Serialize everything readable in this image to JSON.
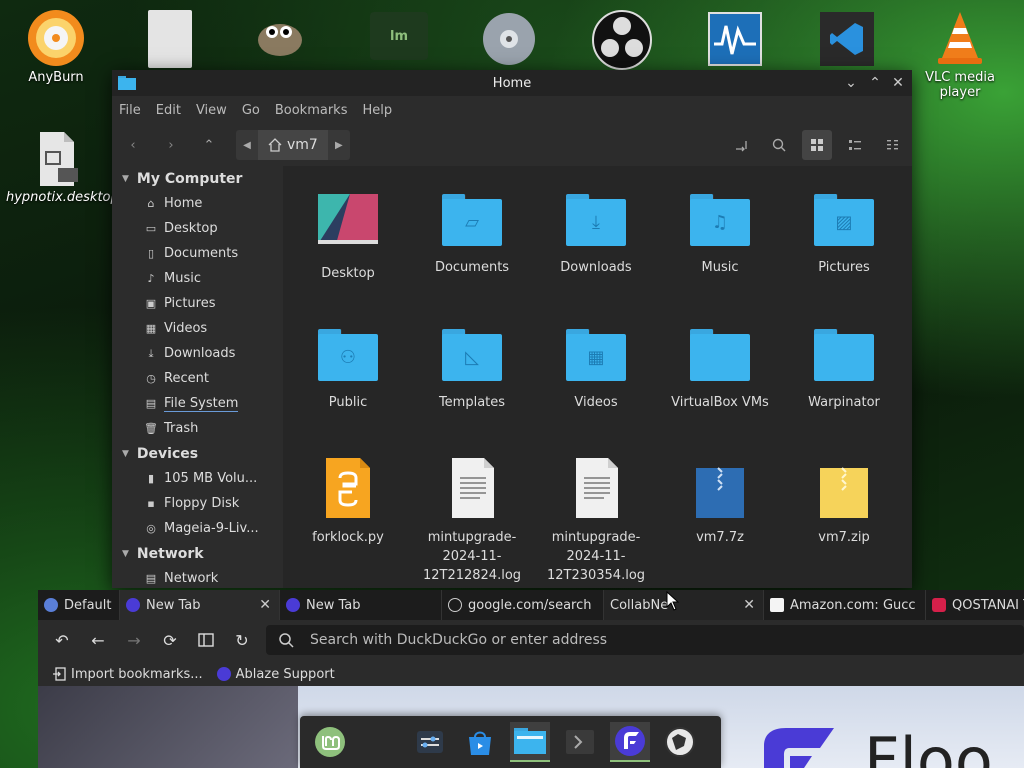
{
  "desktop": {
    "icons": [
      {
        "label": "AnyBurn"
      },
      {
        "label": "hypnotix.desktop"
      },
      {
        "label": "VLC media player"
      }
    ]
  },
  "file_manager": {
    "title": "Home",
    "menu": [
      "File",
      "Edit",
      "View",
      "Go",
      "Bookmarks",
      "Help"
    ],
    "path": "vm7",
    "sidebar": {
      "sections": [
        {
          "title": "My Computer",
          "items": [
            "Home",
            "Desktop",
            "Documents",
            "Music",
            "Pictures",
            "Videos",
            "Downloads",
            "Recent",
            "File System",
            "Trash"
          ]
        },
        {
          "title": "Devices",
          "items": [
            "105 MB Volu...",
            "Floppy Disk",
            "Mageia-9-Liv..."
          ]
        },
        {
          "title": "Network",
          "items": [
            "Network"
          ]
        }
      ]
    },
    "files": [
      {
        "name": "Desktop",
        "kind": "desktop"
      },
      {
        "name": "Documents",
        "kind": "folder",
        "glyph": "document-icon"
      },
      {
        "name": "Downloads",
        "kind": "folder",
        "glyph": "download-icon"
      },
      {
        "name": "Music",
        "kind": "folder",
        "glyph": "music-icon"
      },
      {
        "name": "Pictures",
        "kind": "folder",
        "glyph": "picture-icon"
      },
      {
        "name": "Public",
        "kind": "folder",
        "glyph": "people-icon"
      },
      {
        "name": "Templates",
        "kind": "folder",
        "glyph": "ruler-icon"
      },
      {
        "name": "Videos",
        "kind": "folder",
        "glyph": "film-icon"
      },
      {
        "name": "VirtualBox VMs",
        "kind": "folder",
        "glyph": ""
      },
      {
        "name": "Warpinator",
        "kind": "folder",
        "glyph": ""
      },
      {
        "name": "forklock.py",
        "kind": "python"
      },
      {
        "name": "mintupgrade-2024-11-12T212824.log",
        "line1": "mintupgrade-",
        "line2": "2024-11-",
        "line3": "12T212824.log",
        "kind": "text"
      },
      {
        "name": "mintupgrade-2024-11-12T230354.log",
        "line1": "mintupgrade-",
        "line2": "2024-11-",
        "line3": "12T230354.log",
        "kind": "text"
      },
      {
        "name": "vm7.7z",
        "kind": "archive-blue"
      },
      {
        "name": "vm7.zip",
        "kind": "archive-yellow"
      }
    ]
  },
  "browser": {
    "tabs": [
      {
        "label": "Default",
        "active": false
      },
      {
        "label": "New Tab",
        "active": true
      },
      {
        "label": "New Tab",
        "active": false
      },
      {
        "label": "google.com/search",
        "active": false
      },
      {
        "label": "CollabNe",
        "active": false
      },
      {
        "label": "Amazon.com: Gucc",
        "active": false
      },
      {
        "label": "QOSTANAI T",
        "active": false
      }
    ],
    "url_placeholder": "Search with DuckDuckGo or enter address",
    "bookmarks": [
      "Import bookmarks...",
      "Ablaze Support"
    ]
  },
  "page_fragment": "Floo",
  "colors": {
    "folder": "#3cb4ee",
    "accent_green": "#8ec07c",
    "browser_bg": "#2b2b2b"
  }
}
